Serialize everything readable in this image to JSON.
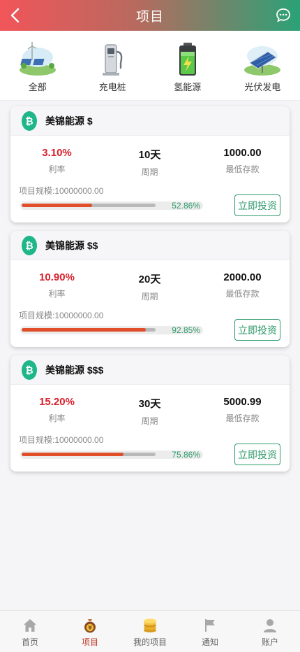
{
  "header": {
    "title": "项目"
  },
  "categories": [
    {
      "label": "全部",
      "icon": "solar-landscape-icon"
    },
    {
      "label": "充电桩",
      "icon": "charging-pile-icon"
    },
    {
      "label": "氢能源",
      "icon": "battery-icon"
    },
    {
      "label": "光伏发电",
      "icon": "solar-panel-icon"
    }
  ],
  "labels": {
    "rate": "利率",
    "period": "周期",
    "min_deposit": "最低存款",
    "invest_button": "立即投资"
  },
  "projects": [
    {
      "name": "美锦能源 $",
      "rate": "3.10%",
      "period": "10天",
      "min_deposit": "1000.00",
      "scale": "项目规模:10000000.00",
      "progress": "52.86%",
      "progress_value": 52.86
    },
    {
      "name": "美锦能源 $$",
      "rate": "10.90%",
      "period": "20天",
      "min_deposit": "2000.00",
      "scale": "项目规模:10000000.00",
      "progress": "92.85%",
      "progress_value": 92.85
    },
    {
      "name": "美锦能源 $$$",
      "rate": "15.20%",
      "period": "30天",
      "min_deposit": "5000.99",
      "scale": "项目规模:10000000.00",
      "progress": "75.86%",
      "progress_value": 75.86
    }
  ],
  "tabbar": [
    {
      "label": "首页",
      "icon": "home-icon"
    },
    {
      "label": "项目",
      "icon": "money-bag-icon",
      "active": true
    },
    {
      "label": "我的项目",
      "icon": "coins-icon"
    },
    {
      "label": "通知",
      "icon": "flag-icon"
    },
    {
      "label": "账户",
      "icon": "user-icon"
    }
  ],
  "colors": {
    "accent_red": "#d9212c",
    "accent_green": "#2e9a6b",
    "progress": "#e04e2a"
  }
}
